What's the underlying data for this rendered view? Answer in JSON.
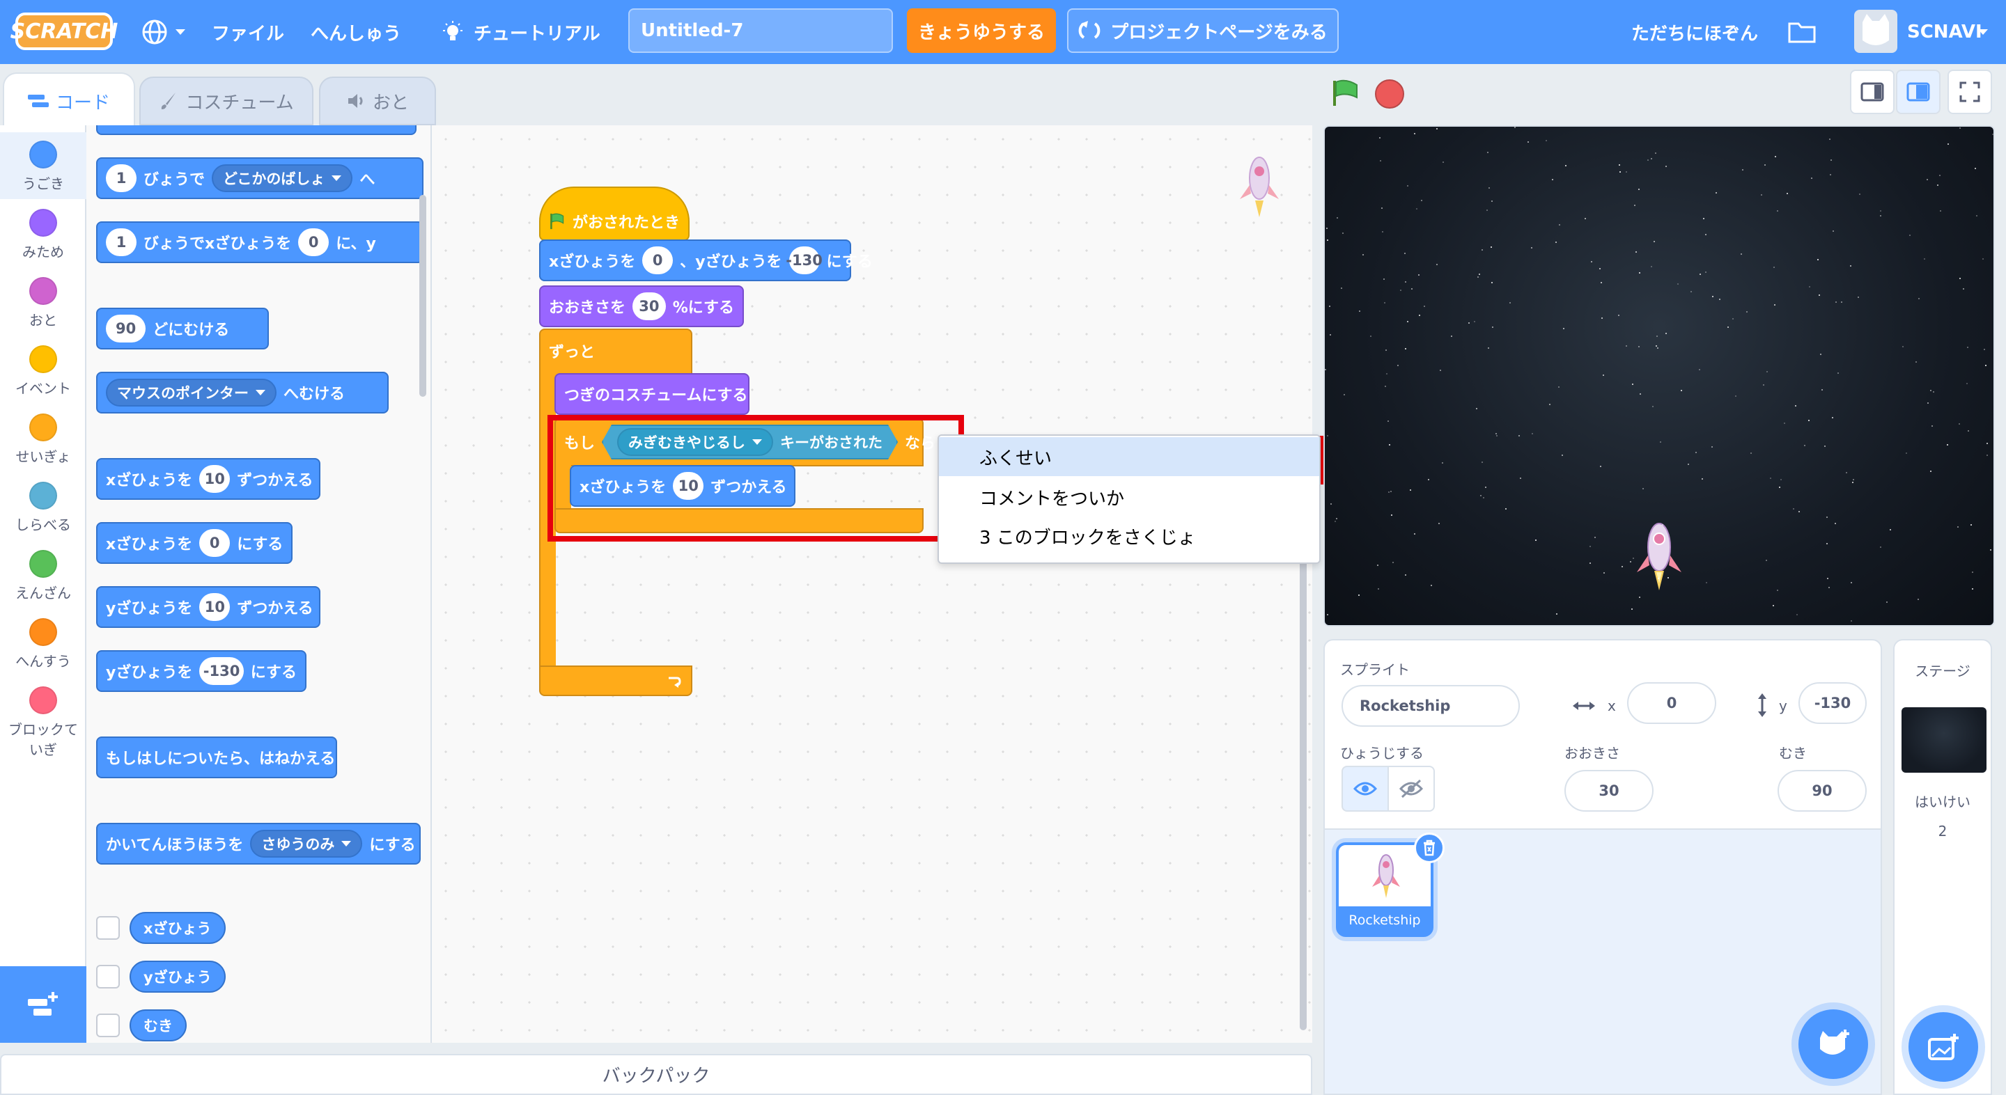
{
  "topbar": {
    "logo": "SCRATCH",
    "file": "ファイル",
    "edit": "へんしゅう",
    "tutorial": "チュートリアル",
    "project_title": "Untitled-7",
    "share": "きょうゆうする",
    "project_page": "プロジェクトページをみる",
    "save_now": "ただちにほぞん",
    "username": "SCNAVI"
  },
  "tabs": {
    "code": "コード",
    "costume": "コスチューム",
    "sound": "おと"
  },
  "categories": [
    {
      "label": "うごき",
      "color": "#4c97ff"
    },
    {
      "label": "みため",
      "color": "#9966ff"
    },
    {
      "label": "おと",
      "color": "#cf63cf"
    },
    {
      "label": "イベント",
      "color": "#ffbf00"
    },
    {
      "label": "せいぎょ",
      "color": "#ffab19"
    },
    {
      "label": "しらべる",
      "color": "#5cb1d6"
    },
    {
      "label": "えんざん",
      "color": "#59c059"
    },
    {
      "label": "へんすう",
      "color": "#ff8c1a"
    },
    {
      "label": "ブロックて",
      "label2": "いぎ",
      "color": "#ff6680"
    }
  ],
  "palette": {
    "glide_secs": "1",
    "glide_text": "びょうで",
    "glide_target": "どこかのばしょ",
    "glide_to": "へ",
    "glidexy_secs": "1",
    "glidexy_text": "びょうでxざひょうを",
    "glidexy_x": "0",
    "glidexy_mid": "に、y",
    "point_val": "90",
    "point_text": "どにむける",
    "towards_target": "マウスのポインター",
    "towards_text": "へむける",
    "changex_text": "xざひょうを",
    "changex_val": "10",
    "changex_end": "ずつかえる",
    "setx_text": "xざひょうを",
    "setx_val": "0",
    "setx_end": "にする",
    "changey_text": "yざひょうを",
    "changey_val": "10",
    "changey_end": "ずつかえる",
    "sety_text": "yざひょうを",
    "sety_val": "-130",
    "sety_end": "にする",
    "bounce": "もしはしについたら、はねかえる",
    "rotation_text": "かいてんほうほうを",
    "rotation_val": "さゆうのみ",
    "rotation_end": "にする",
    "rep_x": "xざひょう",
    "rep_y": "yざひょう",
    "rep_dir": "むき"
  },
  "script": {
    "hat": "がおされたとき",
    "goto_x_label": "xざひょうを",
    "goto_x": "0",
    "goto_y_label": "、yざひょうを",
    "goto_y": "-130",
    "goto_end": "にする",
    "size_label": "おおきさを",
    "size_val": "30",
    "size_end": "%にする",
    "forever": "ずっと",
    "next_costume": "つぎのコスチュームにする",
    "if_label": "もし",
    "key": "みぎむきやじるし",
    "key_pressed": "キーがおされた",
    "then": "なら",
    "inner_label": "xざひょうを",
    "inner_val": "10",
    "inner_end": "ずつかえる"
  },
  "context_menu": [
    "ふくせい",
    "コメントをついか",
    "3 このブロックをさくじょ"
  ],
  "backpack": "バックパック",
  "sprite_info": {
    "sprite_label": "スプライト",
    "sprite_name": "Rocketship",
    "x_label": "x",
    "x_val": "0",
    "y_label": "y",
    "y_val": "-130",
    "show_label": "ひょうじする",
    "size_label": "おおきさ",
    "size_val": "30",
    "direction_label": "むき",
    "direction_val": "90"
  },
  "sprite_tile": "Rocketship",
  "stage_panel": {
    "title": "ステージ",
    "backdrop_label": "はいけい",
    "backdrop_count": "2"
  }
}
